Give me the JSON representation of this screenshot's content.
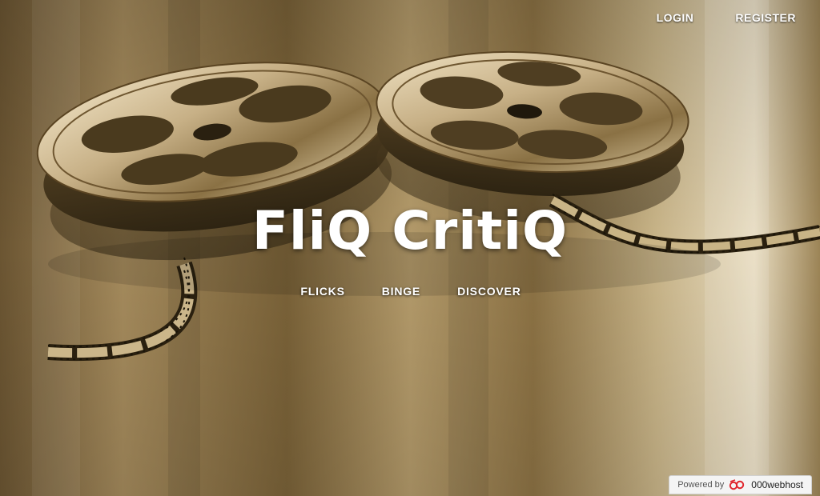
{
  "header": {
    "login_label": "LOGIN",
    "register_label": "REGISTER"
  },
  "hero": {
    "title": "FliQ CritiQ"
  },
  "main_nav": {
    "items": [
      {
        "label": "FLICKS"
      },
      {
        "label": "BINGE"
      },
      {
        "label": "DISCOVER"
      }
    ]
  },
  "footer_badge": {
    "powered_by": "Powered by",
    "brand": "000webhost",
    "logo_icon": "000webhost-logo-icon",
    "logo_color": "#e0262d"
  },
  "theme": {
    "background_tone": "#8a7348",
    "text_color": "#ffffff"
  }
}
